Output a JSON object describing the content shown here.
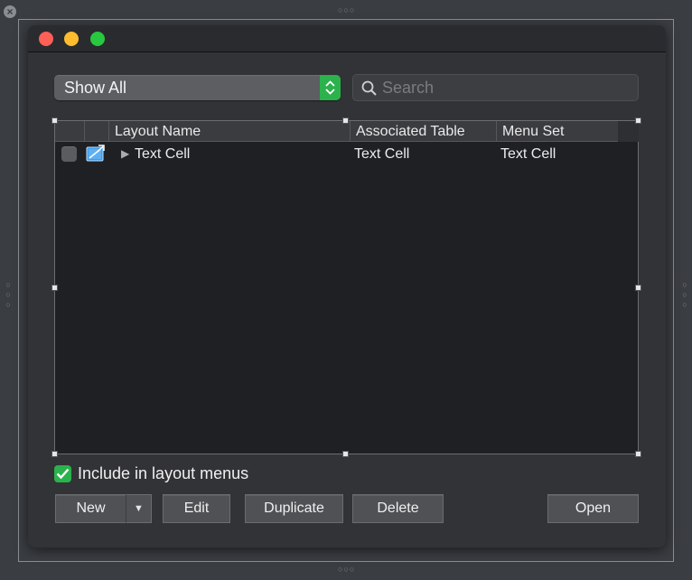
{
  "filter": {
    "selected": "Show All"
  },
  "search": {
    "placeholder": "Search",
    "value": ""
  },
  "table": {
    "columns": [
      "Layout Name",
      "Associated Table",
      "Menu Set"
    ],
    "rows": [
      {
        "checked": false,
        "layout_name": "Text Cell",
        "associated_table": "Text Cell",
        "menu_set": "Text Cell"
      }
    ]
  },
  "include_in_menus": {
    "label": "Include in layout menus",
    "checked": true
  },
  "buttons": {
    "new": "New",
    "edit": "Edit",
    "duplicate": "Duplicate",
    "delete": "Delete",
    "open": "Open"
  },
  "icons": {
    "row_icon": "layout-icon",
    "disclosure": "disclosure-triangle-icon",
    "search": "search-icon",
    "popup": "chevron-updown-icon",
    "split": "chevron-down-icon",
    "canvas_close": "close-icon"
  },
  "colors": {
    "accent": "#2bb24c",
    "close": "#fe5f57",
    "minimize": "#febc2e",
    "zoom": "#28c840"
  }
}
